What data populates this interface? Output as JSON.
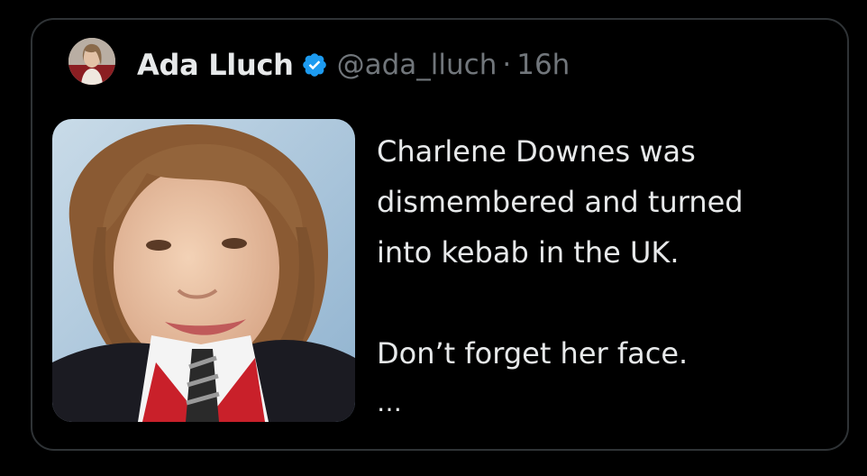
{
  "author": {
    "display_name": "Ada Lluch",
    "handle": "@ada_lluch",
    "separator": "·",
    "timestamp": "16h",
    "verified_icon": "verified-badge-icon",
    "badge_color": "#1d9bf0"
  },
  "tweet": {
    "lines": [
      "Charlene Downes was",
      "dismembered and turned",
      "into kebab in the UK.",
      "Don’t forget her face."
    ],
    "more": "…"
  },
  "colors": {
    "background": "#000000",
    "text_primary": "#e7e9ea",
    "text_secondary": "#71767b",
    "border": "#2f3336"
  }
}
